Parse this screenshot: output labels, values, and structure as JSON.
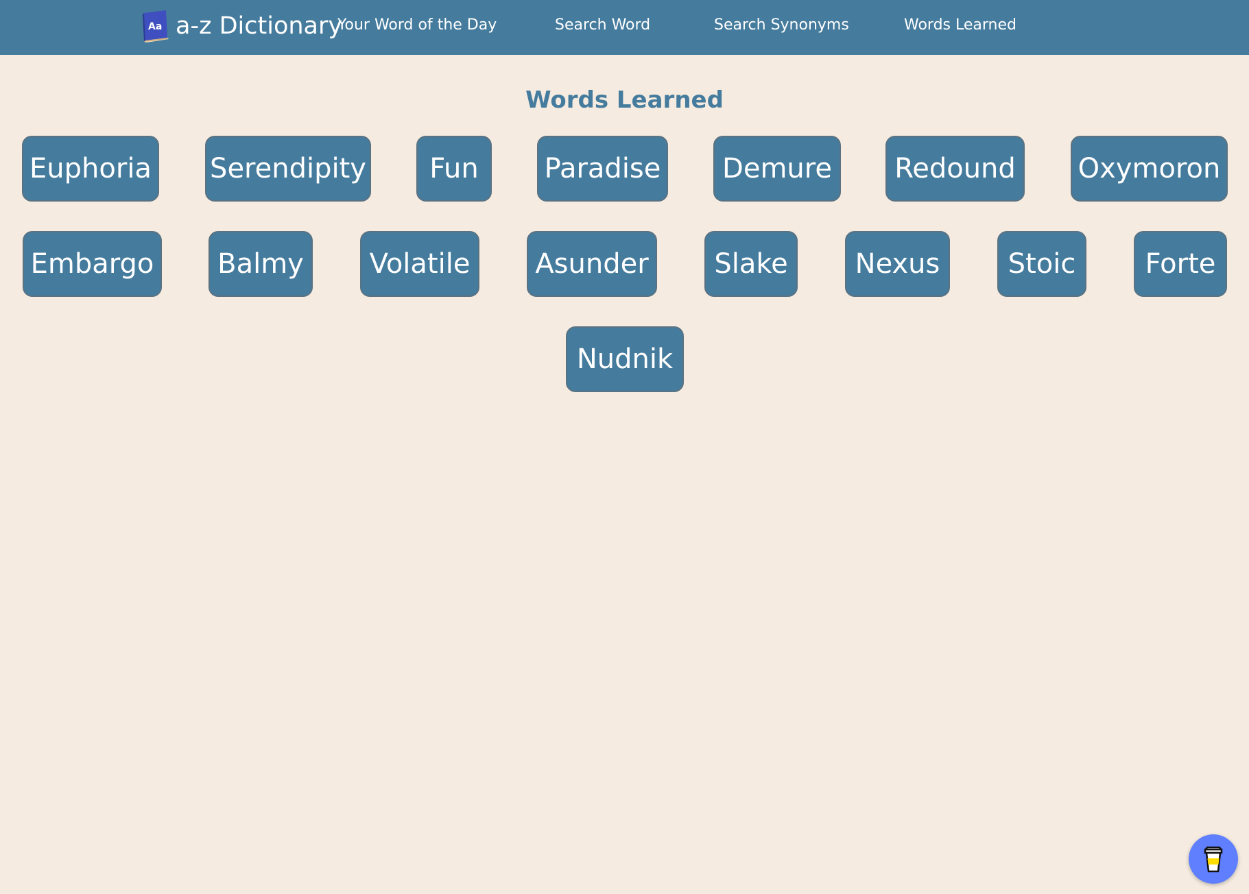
{
  "nav": {
    "brand": "a-z Dictionary",
    "brand_icon_text": "Aa",
    "links": [
      "Your Word of the Day",
      "Search Word",
      "Search Synonyms",
      "Words Learned"
    ]
  },
  "main": {
    "title": "Words Learned",
    "words": [
      "Euphoria",
      "Serendipity",
      "Fun",
      "Paradise",
      "Demure",
      "Redound",
      "Oxymoron",
      "Embargo",
      "Balmy",
      "Volatile",
      "Asunder",
      "Slake",
      "Nexus",
      "Stoic",
      "Forte",
      "Nudnik"
    ]
  },
  "widgets": {
    "coffee_icon": "coffee-cup-icon"
  },
  "colors": {
    "nav_background": "#457b9d",
    "page_background": "#f5ebe0",
    "word_button": "#457b9d",
    "title_text": "#457b9d",
    "coffee_button": "#5f7fff"
  }
}
